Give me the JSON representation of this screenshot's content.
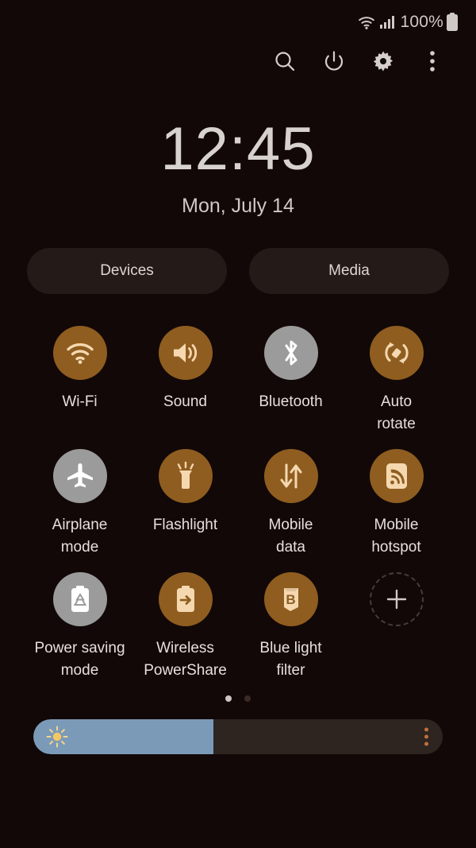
{
  "colors": {
    "background": "#120807",
    "tile_on": "#8f5d20",
    "tile_off": "#9b9b9b",
    "icon_on": "#f5d8b0",
    "icon_off": "#ffffff",
    "pill_bg": "#241a17",
    "slider_fill": "#7b9ab8",
    "slider_track": "#2e2420",
    "accent": "#c0703a"
  },
  "status_bar": {
    "wifi_icon": "wifi-icon",
    "signal_icon": "cellular-signal-icon",
    "battery_percent": "100%",
    "battery_icon": "battery-full-icon"
  },
  "toolbar": {
    "buttons": [
      {
        "name": "search-icon",
        "label": "Search"
      },
      {
        "name": "power-icon",
        "label": "Power off"
      },
      {
        "name": "settings-icon",
        "label": "Settings"
      },
      {
        "name": "overflow-icon",
        "label": "More options"
      }
    ]
  },
  "clock": {
    "time": "12:45",
    "date": "Mon, July 14"
  },
  "pills": [
    {
      "label": "Devices"
    },
    {
      "label": "Media"
    }
  ],
  "tiles": [
    {
      "label": "Wi-Fi",
      "icon": "wifi-icon",
      "state": "on"
    },
    {
      "label": "Sound",
      "icon": "volume-icon",
      "state": "on"
    },
    {
      "label": "Bluetooth",
      "icon": "bluetooth-icon",
      "state": "off"
    },
    {
      "label": "Auto\nrotate",
      "icon": "auto-rotate-icon",
      "state": "on"
    },
    {
      "label": "Airplane\nmode",
      "icon": "airplane-icon",
      "state": "off"
    },
    {
      "label": "Flashlight",
      "icon": "flashlight-icon",
      "state": "on"
    },
    {
      "label": "Mobile\ndata",
      "icon": "mobile-data-icon",
      "state": "on"
    },
    {
      "label": "Mobile\nhotspot",
      "icon": "hotspot-icon",
      "state": "on"
    },
    {
      "label": "Power saving\nmode",
      "icon": "power-saving-icon",
      "state": "off"
    },
    {
      "label": "Wireless\nPowerShare",
      "icon": "powershare-icon",
      "state": "on"
    },
    {
      "label": "Blue light\nfilter",
      "icon": "blue-light-icon",
      "state": "on"
    },
    {
      "label": "",
      "icon": "add-icon",
      "state": "add"
    }
  ],
  "page_indicator": {
    "total": 2,
    "active": 1
  },
  "brightness": {
    "value_percent": 44,
    "sun_icon": "brightness-sun-icon",
    "menu_icon": "overflow-icon"
  }
}
